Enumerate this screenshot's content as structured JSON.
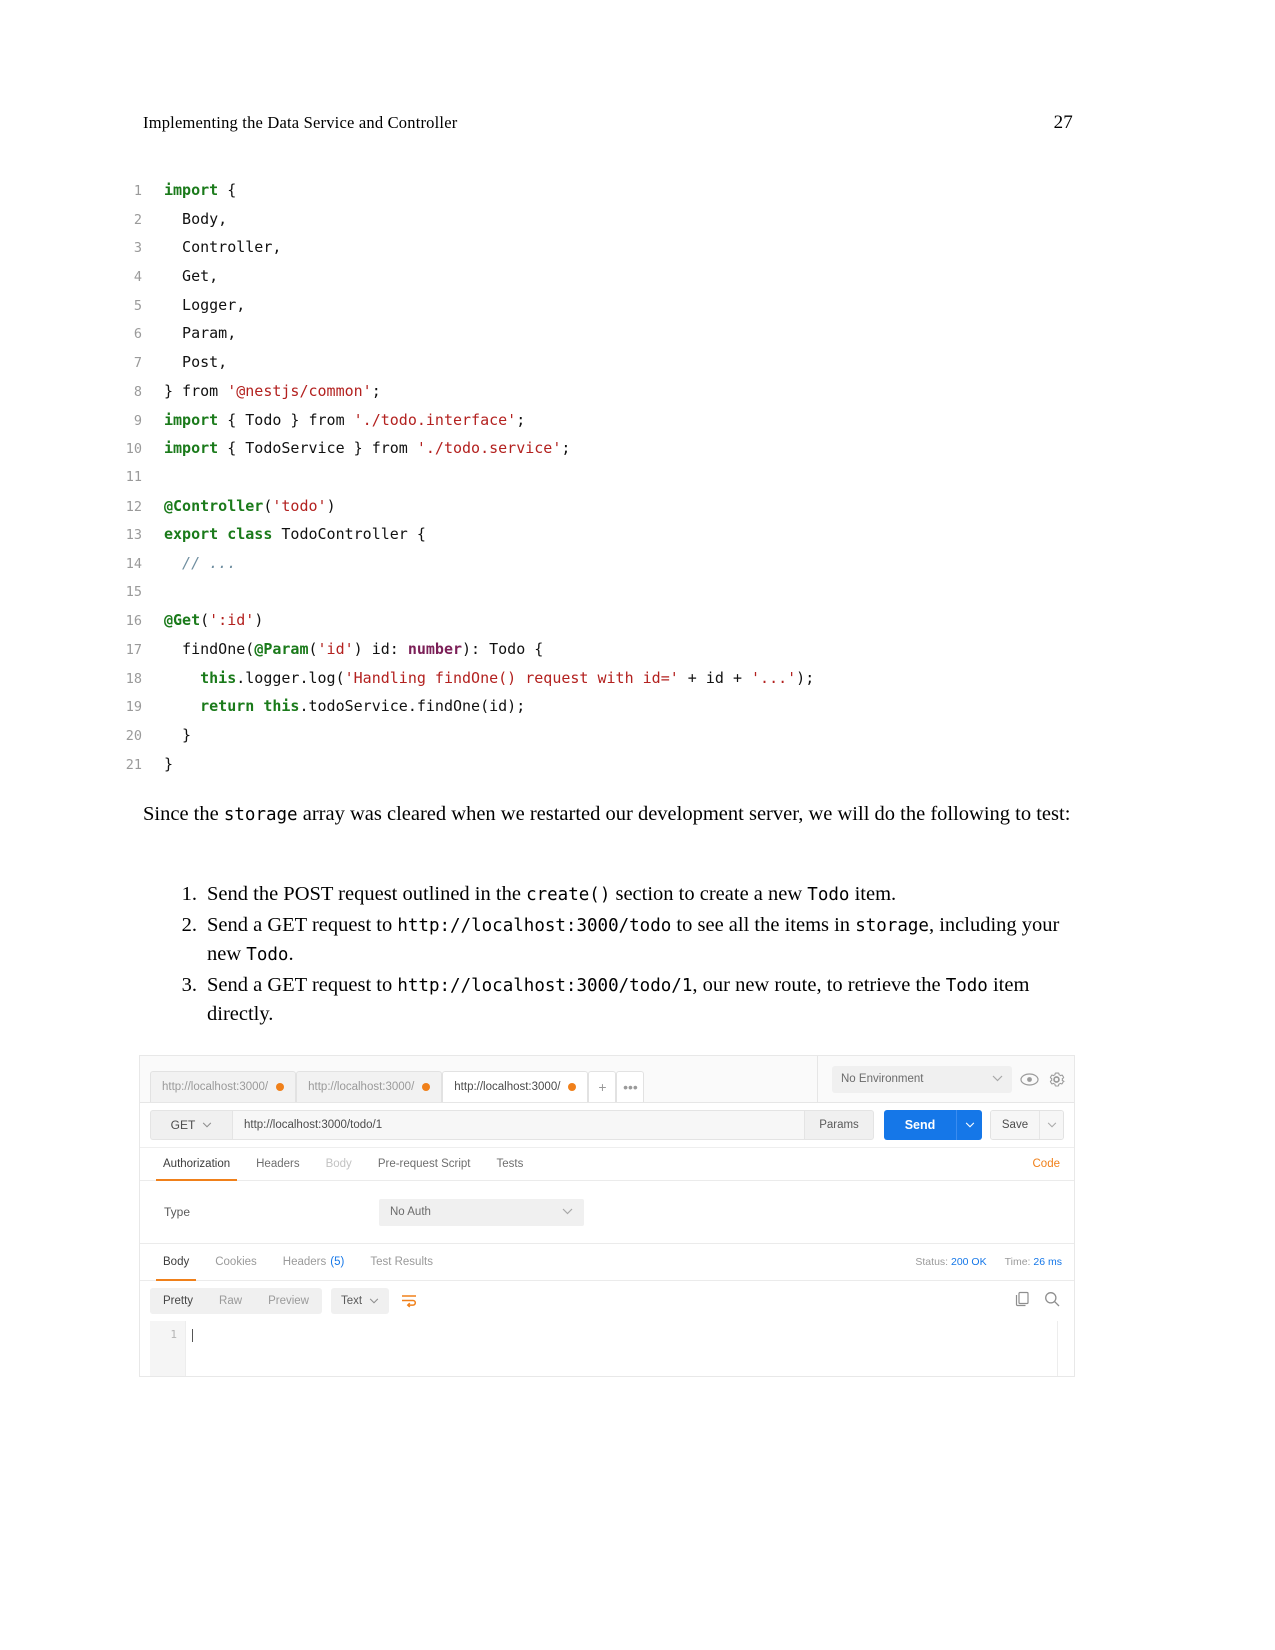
{
  "header": {
    "chapter_title": "Implementing the Data Service and Controller",
    "page_number": "27"
  },
  "code": {
    "language": "typescript",
    "lines": [
      {
        "n": "1",
        "tokens": [
          {
            "t": "import",
            "c": "kw"
          },
          {
            "t": " {",
            "c": "pln"
          }
        ]
      },
      {
        "n": "2",
        "tokens": [
          {
            "t": "  Body,",
            "c": "pln"
          }
        ]
      },
      {
        "n": "3",
        "tokens": [
          {
            "t": "  Controller,",
            "c": "pln"
          }
        ]
      },
      {
        "n": "4",
        "tokens": [
          {
            "t": "  Get,",
            "c": "pln"
          }
        ]
      },
      {
        "n": "5",
        "tokens": [
          {
            "t": "  Logger,",
            "c": "pln"
          }
        ]
      },
      {
        "n": "6",
        "tokens": [
          {
            "t": "  Param,",
            "c": "pln"
          }
        ]
      },
      {
        "n": "7",
        "tokens": [
          {
            "t": "  Post,",
            "c": "pln"
          }
        ]
      },
      {
        "n": "8",
        "tokens": [
          {
            "t": "} from ",
            "c": "pln"
          },
          {
            "t": "'@nestjs/common'",
            "c": "str"
          },
          {
            "t": ";",
            "c": "pln"
          }
        ]
      },
      {
        "n": "9",
        "tokens": [
          {
            "t": "import",
            "c": "kw"
          },
          {
            "t": " { Todo } from ",
            "c": "pln"
          },
          {
            "t": "'./todo.interface'",
            "c": "str"
          },
          {
            "t": ";",
            "c": "pln"
          }
        ]
      },
      {
        "n": "10",
        "tokens": [
          {
            "t": "import",
            "c": "kw"
          },
          {
            "t": " { TodoService } from ",
            "c": "pln"
          },
          {
            "t": "'./todo.service'",
            "c": "str"
          },
          {
            "t": ";",
            "c": "pln"
          }
        ]
      },
      {
        "n": "11",
        "tokens": [
          {
            "t": "",
            "c": "pln"
          }
        ]
      },
      {
        "n": "12",
        "tokens": [
          {
            "t": "@Controller",
            "c": "dec"
          },
          {
            "t": "(",
            "c": "pln"
          },
          {
            "t": "'todo'",
            "c": "str"
          },
          {
            "t": ")",
            "c": "pln"
          }
        ]
      },
      {
        "n": "13",
        "tokens": [
          {
            "t": "export class",
            "c": "kw"
          },
          {
            "t": " TodoController {",
            "c": "pln"
          }
        ]
      },
      {
        "n": "14",
        "tokens": [
          {
            "t": "  // ...",
            "c": "cmt"
          }
        ]
      },
      {
        "n": "15",
        "tokens": [
          {
            "t": "",
            "c": "pln"
          }
        ]
      },
      {
        "n": "16",
        "tokens": [
          {
            "t": "@Get",
            "c": "dec"
          },
          {
            "t": "(",
            "c": "pln"
          },
          {
            "t": "':id'",
            "c": "str"
          },
          {
            "t": ")",
            "c": "pln"
          }
        ]
      },
      {
        "n": "17",
        "tokens": [
          {
            "t": "  findOne(",
            "c": "pln"
          },
          {
            "t": "@Param",
            "c": "dec"
          },
          {
            "t": "(",
            "c": "pln"
          },
          {
            "t": "'id'",
            "c": "str"
          },
          {
            "t": ") id: ",
            "c": "pln"
          },
          {
            "t": "number",
            "c": "typ"
          },
          {
            "t": "): Todo {",
            "c": "pln"
          }
        ]
      },
      {
        "n": "18",
        "tokens": [
          {
            "t": "    ",
            "c": "pln"
          },
          {
            "t": "this",
            "c": "kw"
          },
          {
            "t": ".logger.log(",
            "c": "pln"
          },
          {
            "t": "'Handling findOne() request with id='",
            "c": "str"
          },
          {
            "t": " + id + ",
            "c": "pln"
          },
          {
            "t": "'...'",
            "c": "str"
          },
          {
            "t": ");",
            "c": "pln"
          }
        ]
      },
      {
        "n": "19",
        "tokens": [
          {
            "t": "    ",
            "c": "pln"
          },
          {
            "t": "return this",
            "c": "kw"
          },
          {
            "t": ".todoService.findOne(id);",
            "c": "pln"
          }
        ]
      },
      {
        "n": "20",
        "tokens": [
          {
            "t": "  }",
            "c": "pln"
          }
        ]
      },
      {
        "n": "21",
        "tokens": [
          {
            "t": "}",
            "c": "pln"
          }
        ]
      }
    ]
  },
  "paragraph": {
    "part1": "Since the ",
    "mono1": "storage",
    "part2": " array was cleared when we restarted our development server, we will do the following to test:"
  },
  "steps": [
    {
      "num": "1.",
      "segments": [
        {
          "t": "Send the POST request outlined in the ",
          "mono": false
        },
        {
          "t": "create()",
          "mono": true
        },
        {
          "t": " section to create a new ",
          "mono": false
        },
        {
          "t": "Todo",
          "mono": true
        },
        {
          "t": " item.",
          "mono": false
        }
      ]
    },
    {
      "num": "2.",
      "segments": [
        {
          "t": "Send a GET request to ",
          "mono": false
        },
        {
          "t": "http://localhost:3000/todo",
          "mono": true
        },
        {
          "t": " to see all the items in ",
          "mono": false
        },
        {
          "t": "storage",
          "mono": true
        },
        {
          "t": ", including your new ",
          "mono": false
        },
        {
          "t": "Todo",
          "mono": true
        },
        {
          "t": ".",
          "mono": false
        }
      ]
    },
    {
      "num": "3.",
      "segments": [
        {
          "t": "Send a GET request to ",
          "mono": false
        },
        {
          "t": "http://localhost:3000/todo/1",
          "mono": true
        },
        {
          "t": ", our new route, to retrieve the ",
          "mono": false
        },
        {
          "t": "Todo",
          "mono": true
        },
        {
          "t": " item directly.",
          "mono": false
        }
      ]
    }
  ],
  "postman": {
    "tabs": [
      {
        "label": "http://localhost:3000/",
        "active": false,
        "unsaved": true
      },
      {
        "label": "http://localhost:3000/",
        "active": false,
        "unsaved": true
      },
      {
        "label": "http://localhost:3000/",
        "active": true,
        "unsaved": true
      }
    ],
    "tab_add_label": "+",
    "tab_more_label": "•••",
    "environment": {
      "value": "No Environment",
      "chevron": "chevron-down-icon",
      "eye_icon": "eye-icon",
      "gear_icon": "gear-icon"
    },
    "request": {
      "method": "GET",
      "url": "http://localhost:3000/todo/1",
      "params_label": "Params",
      "send_label": "Send",
      "save_label": "Save"
    },
    "request_tabs": [
      {
        "label": "Authorization",
        "state": "active"
      },
      {
        "label": "Headers",
        "state": "normal"
      },
      {
        "label": "Body",
        "state": "dim"
      },
      {
        "label": "Pre-request Script",
        "state": "normal"
      },
      {
        "label": "Tests",
        "state": "normal"
      }
    ],
    "code_link": "Code",
    "auth": {
      "type_label": "Type",
      "type_value": "No Auth"
    },
    "response_tabs": [
      {
        "label": "Body",
        "active": true,
        "count": ""
      },
      {
        "label": "Cookies",
        "active": false,
        "count": ""
      },
      {
        "label": "Headers",
        "active": false,
        "count": "(5)"
      },
      {
        "label": "Test Results",
        "active": false,
        "count": ""
      }
    ],
    "status": {
      "status_label": "Status:",
      "status_value": "200 OK",
      "time_label": "Time:",
      "time_value": "26 ms"
    },
    "body_toolbar": {
      "view_modes": [
        {
          "label": "Pretty",
          "active": true
        },
        {
          "label": "Raw",
          "active": false
        },
        {
          "label": "Preview",
          "active": false
        }
      ],
      "format": "Text",
      "wrap_icon": "word-wrap-icon",
      "copy_icon": "copy-icon",
      "search_icon": "search-icon"
    },
    "response_body": {
      "line_number": "1",
      "content": ""
    }
  },
  "colors": {
    "accent_orange": "#f0801a",
    "accent_blue": "#1577e8",
    "code_keyword": "#1a7a1a",
    "code_string": "#b3211f",
    "code_comment": "#6f8ea0",
    "code_type": "#7b1f57"
  }
}
